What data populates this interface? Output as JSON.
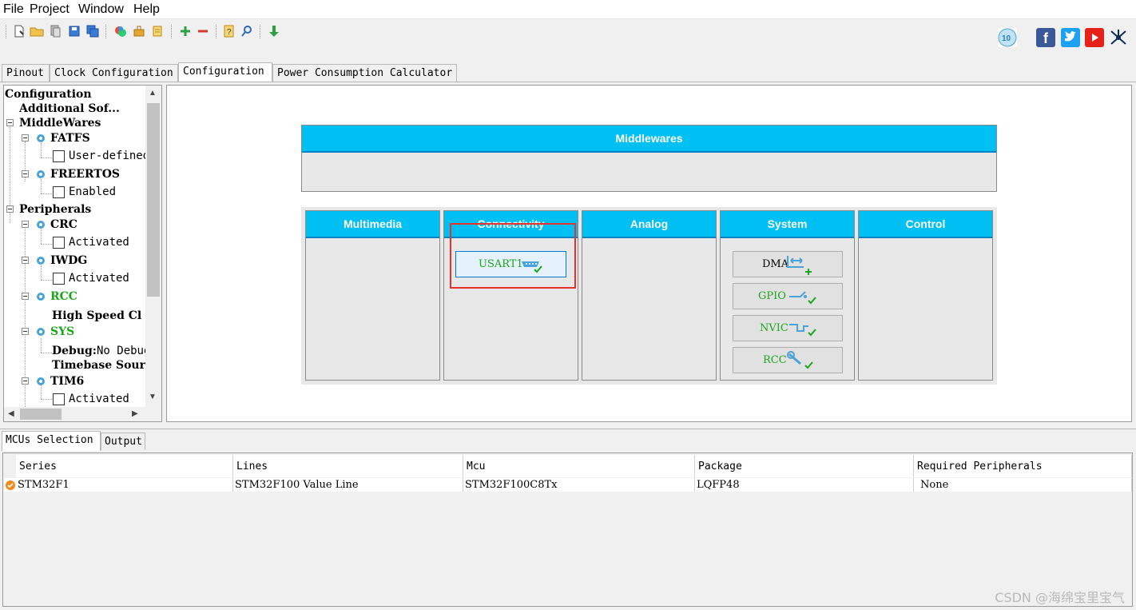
{
  "menu": [
    "File",
    "Project",
    "Window",
    "Help"
  ],
  "toolbar": {
    "buttons": [
      "new-project-icon",
      "open-folder-icon",
      "copy-icon",
      "save-icon",
      "save-all-icon",
      "generate-report-icon",
      "pinout-tool-icon",
      "scroll-report-icon",
      "add-icon",
      "remove-icon",
      "help-icon",
      "search-icon",
      "download-icon"
    ],
    "social": [
      "update-icon",
      "facebook-icon",
      "twitter-icon",
      "youtube-icon",
      "network-icon"
    ],
    "colors": {
      "facebook": "#3b5998",
      "twitter": "#1da1f2",
      "youtube": "#e62117"
    }
  },
  "tabs": [
    "Pinout",
    "Clock Configuration",
    "Configuration",
    "Power Consumption Calculator"
  ],
  "tree": {
    "root": "Configuration",
    "additional": "Additional Sof...",
    "middlewares": "MiddleWares",
    "fatfs": "FATFS",
    "fatfs_opt": "User-defined",
    "freertos": "FREERTOS",
    "freertos_opt": "Enabled",
    "peripherals": "Peripherals",
    "crc": "CRC",
    "crc_opt": "Activated",
    "iwdg": "IWDG",
    "iwdg_opt": "Activated",
    "rcc": "RCC",
    "rcc_opt": "High Speed Cl",
    "sys": "SYS",
    "sys_debug_key": "Debug:",
    "sys_debug_val": "No Debug",
    "sys_timebase": "Timebase Sour",
    "tim6": "TIM6",
    "tim6_opt": "Activated"
  },
  "main": {
    "middlewares": "Middlewares",
    "categories": [
      "Multimedia",
      "Connectivity",
      "Analog",
      "System",
      "Control"
    ],
    "connectivity_buttons": [
      "USART1"
    ],
    "system_buttons": [
      "DMA",
      "GPIO",
      "NVIC",
      "RCC"
    ],
    "colors": {
      "header": "#00bff3",
      "highlight": "#e8302e",
      "active_text": "#1ba61b"
    }
  },
  "bottom": {
    "tabs": [
      "MCUs Selection",
      "Output"
    ],
    "columns": [
      "Series",
      "Lines",
      "Mcu",
      "Package",
      "Required Peripherals"
    ],
    "rows": [
      [
        "STM32F1",
        "STM32F100 Value Line",
        "STM32F100C8Tx",
        "LQFP48",
        "None"
      ]
    ]
  },
  "watermark": "CSDN @海绵宝里宝气"
}
